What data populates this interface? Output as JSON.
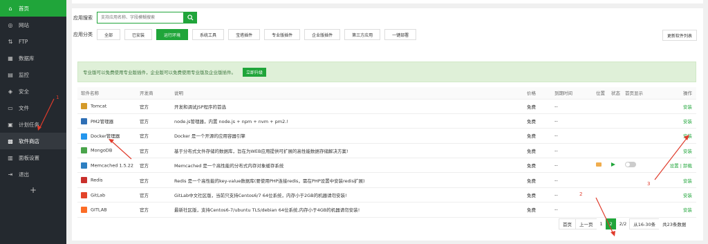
{
  "sidebar": {
    "items": [
      {
        "label": "首页",
        "icon": "home-icon",
        "glyph": "⌂"
      },
      {
        "label": "网站",
        "icon": "globe-icon",
        "glyph": "◎"
      },
      {
        "label": "FTP",
        "icon": "ftp-icon",
        "glyph": "⇅"
      },
      {
        "label": "数据库",
        "icon": "database-icon",
        "glyph": "▦"
      },
      {
        "label": "监控",
        "icon": "monitor-icon",
        "glyph": "▤"
      },
      {
        "label": "安全",
        "icon": "shield-icon",
        "glyph": "◈"
      },
      {
        "label": "文件",
        "icon": "folder-icon",
        "glyph": "▭"
      },
      {
        "label": "计划任务",
        "icon": "calendar-icon",
        "glyph": "▣"
      },
      {
        "label": "软件商店",
        "icon": "store-icon",
        "glyph": "▩"
      },
      {
        "label": "面板设置",
        "icon": "settings-icon",
        "glyph": "▥"
      },
      {
        "label": "退出",
        "icon": "logout-icon",
        "glyph": "⇥"
      }
    ],
    "add": "+"
  },
  "search": {
    "label": "应用搜索",
    "placeholder": "支持应用名称、字段模糊搜索"
  },
  "categories": {
    "label": "应用分类",
    "items": [
      "全部",
      "已安装",
      "运行环境",
      "系统工具",
      "宝塔插件",
      "专业版插件",
      "企业版插件",
      "第三方应用",
      "一键部署"
    ],
    "selected": "运行环境"
  },
  "update_list": "更新软件列表",
  "notice": {
    "text": "专业版可以免费使用专业版插件，企业版可以免费使用专业版及企业版插件。",
    "button": "立即升级"
  },
  "table": {
    "headers": [
      "软件名称",
      "开发商",
      "说明",
      "价格",
      "到期时间",
      "位置",
      "状态",
      "首页显示",
      "操作"
    ],
    "rows": [
      {
        "name": "Tomcat",
        "vendor": "官方",
        "desc": "开发和调试JSP程序的首选",
        "price": "免费",
        "expire": "--",
        "op": "安装",
        "color": "#d49a2a"
      },
      {
        "name": "PM2管理器",
        "vendor": "官方",
        "desc": "node.js管理器，内置 node.js + npm + nvm + pm2.!",
        "price": "免费",
        "expire": "--",
        "op": "安装",
        "color": "#2f6fb5"
      },
      {
        "name": "Docker管理器",
        "vendor": "官方",
        "desc": "Docker 是一个开源的应用容器引擎",
        "price": "免费",
        "expire": "--",
        "op": "安装",
        "color": "#2496ed"
      },
      {
        "name": "MongoDB",
        "vendor": "官方",
        "desc": "基于分布式文件存储的数据库，旨在为WEB应用提供可扩展的高性能数据存储解决方案!",
        "price": "免费",
        "expire": "--",
        "op": "安装",
        "color": "#4aa44b"
      },
      {
        "name": "Memcached 1.5.22",
        "vendor": "官方",
        "desc": "Memcached 是一个高性能的分布式内存对象缓存系统",
        "price": "免费",
        "expire": "--",
        "op": "设置 | 卸载",
        "color": "#2d7fc1"
      },
      {
        "name": "Redis",
        "vendor": "官方",
        "desc": "Redis 是一个高性能的key-value数据库(要使用PHP连接redis，需在PHP设置中安装redis扩展)",
        "price": "免费",
        "expire": "--",
        "op": "安装",
        "color": "#c9302c"
      },
      {
        "name": "GitLab",
        "vendor": "官方",
        "desc": "GitLab中文社区版，当前只支持Centos6/7 64位系统，内存小于2GB的机器请勿安装!",
        "price": "免费",
        "expire": "--",
        "op": "安装",
        "color": "#e24329"
      },
      {
        "name": "GITLAB",
        "vendor": "官方",
        "desc": "最新社区版，支持Centos6-7/ubuntu TLS/debian 64位系统,内存小于4GB的机器请勿安装!",
        "price": "免费",
        "expire": "--",
        "op": "安装",
        "color": "#fc6d26"
      }
    ]
  },
  "pager": {
    "first": "首页",
    "prev": "上一页",
    "p1": "1",
    "p2": "2",
    "pages": "2/2",
    "range": "从16-30条",
    "total": "共23条数据"
  },
  "annotations": {
    "a1": "1",
    "a2": "2",
    "a3": "3",
    "color": "#e03b2b"
  },
  "colors": {
    "accent": "#20a53a",
    "sidebar": "#24292f"
  }
}
